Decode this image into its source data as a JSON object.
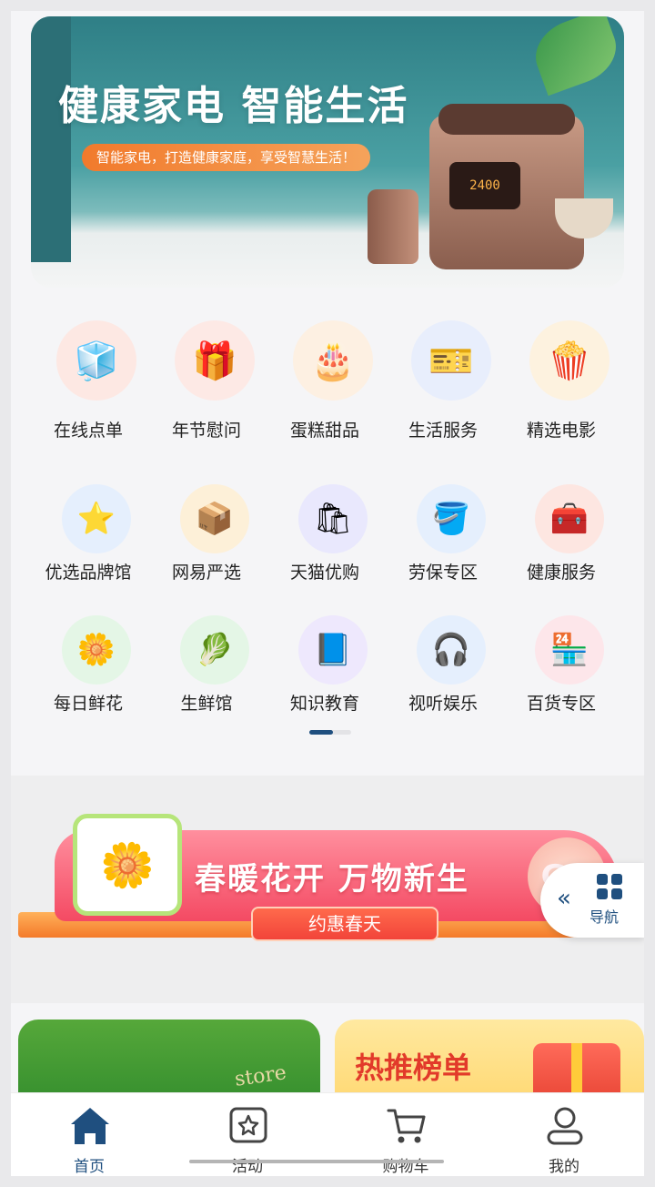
{
  "hero": {
    "title": "健康家电 智能生活",
    "tagline": "智能家电，打造健康家庭，享受智慧生活！",
    "display_reading": "2400"
  },
  "grid": {
    "items": [
      {
        "label": "在线点单",
        "icon": "fridge-icon",
        "bg": "#fde8e3",
        "glyph": "🧊"
      },
      {
        "label": "年节慰问",
        "icon": "gift-basket-icon",
        "bg": "#fde9e5",
        "glyph": "🎁"
      },
      {
        "label": "蛋糕甜品",
        "icon": "cake-icon",
        "bg": "#fdf0e2",
        "glyph": "🎂"
      },
      {
        "label": "生活服务",
        "icon": "coupon-hand-icon",
        "bg": "#e8eefc",
        "glyph": "🎫"
      },
      {
        "label": "精选电影",
        "icon": "popcorn-icon",
        "bg": "#fdf2df",
        "glyph": "🍿"
      },
      {
        "label": "优选品牌馆",
        "icon": "star-r-icon",
        "bg": "#e5effd",
        "glyph": "⭐"
      },
      {
        "label": "网易严选",
        "icon": "box-icon",
        "bg": "#fdf0d8",
        "glyph": "📦"
      },
      {
        "label": "天猫优购",
        "icon": "shopping-bag-icon",
        "bg": "#e9e8fd",
        "glyph": "🛍"
      },
      {
        "label": "劳保专区",
        "icon": "cleaning-bucket-icon",
        "bg": "#e5effd",
        "glyph": "🪣"
      },
      {
        "label": "健康服务",
        "icon": "medical-kit-icon",
        "bg": "#fde6e1",
        "glyph": "🧰"
      },
      {
        "label": "每日鲜花",
        "icon": "flower-icon",
        "bg": "#e4f6e6",
        "glyph": "🌼"
      },
      {
        "label": "生鲜馆",
        "icon": "vegetable-basket-icon",
        "bg": "#e4f6e6",
        "glyph": "🥬"
      },
      {
        "label": "知识教育",
        "icon": "book-icon",
        "bg": "#eee8fd",
        "glyph": "📘"
      },
      {
        "label": "视听娱乐",
        "icon": "headphones-icon",
        "bg": "#e5effd",
        "glyph": "🎧"
      },
      {
        "label": "百货专区",
        "icon": "storefront-icon",
        "bg": "#fde6ea",
        "glyph": "🏪"
      }
    ]
  },
  "pager": {
    "current_page": 1,
    "total_pages": 2
  },
  "promo": {
    "title": "春暖花开 万物新生",
    "subtitle": "约惠春天",
    "badge": "GO"
  },
  "nav_float": {
    "label": "导航"
  },
  "cards": {
    "left_text": "store",
    "right_title": "热推榜单"
  },
  "tabbar": {
    "tabs": [
      {
        "label": "首页",
        "active": true
      },
      {
        "label": "活动",
        "active": false
      },
      {
        "label": "购物车",
        "active": false
      },
      {
        "label": "我的",
        "active": false
      }
    ]
  },
  "colors": {
    "accent": "#1f4f7f",
    "promo_red": "#f44a63",
    "hero_teal": "#2f7f86"
  }
}
